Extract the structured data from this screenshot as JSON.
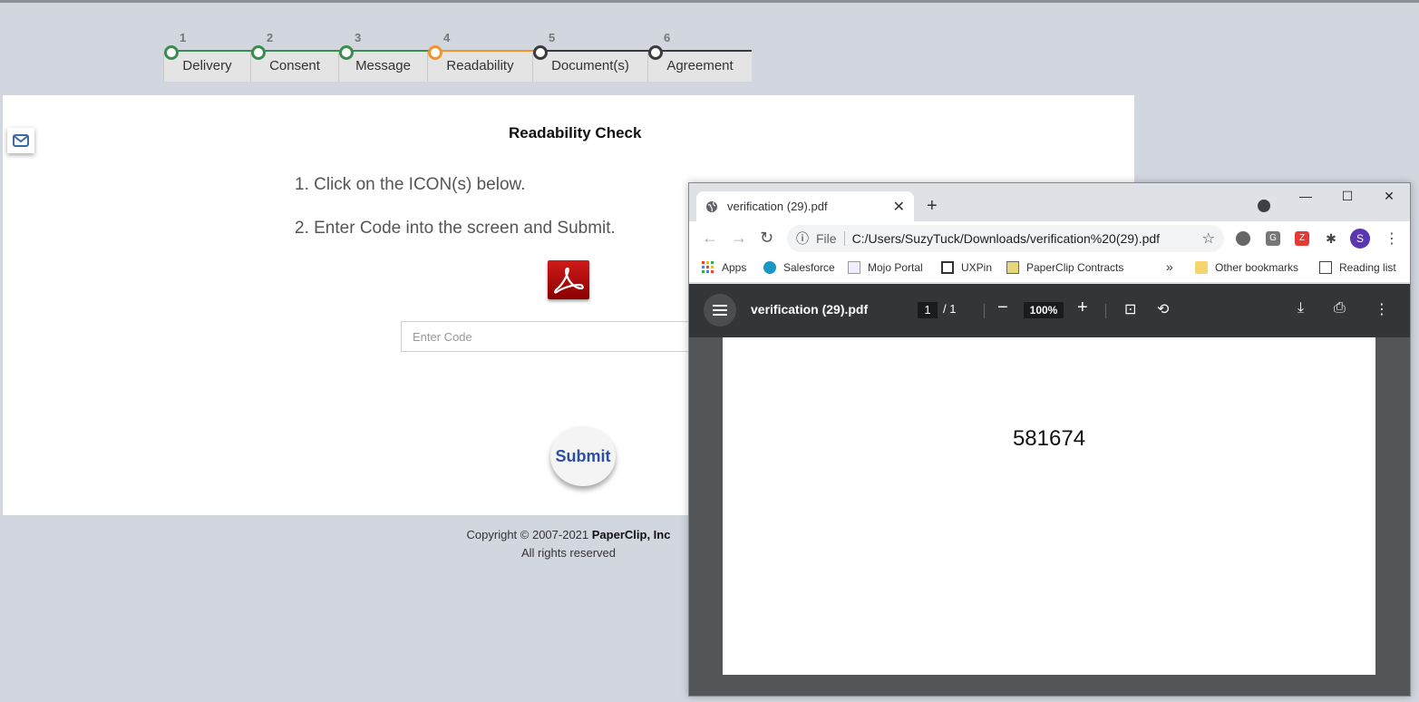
{
  "steps": [
    {
      "num": "1",
      "label": "Delivery",
      "color": "#3b8d4f"
    },
    {
      "num": "2",
      "label": "Consent",
      "color": "#3b8d4f"
    },
    {
      "num": "3",
      "label": "Message",
      "color": "#3b8d4f"
    },
    {
      "num": "4",
      "label": "Readability",
      "color": "#f0952a"
    },
    {
      "num": "5",
      "label": "Document(s)",
      "color": "#3d3a3f"
    },
    {
      "num": "6",
      "label": "Agreement",
      "color": "#3d3a3f"
    }
  ],
  "main": {
    "title": "Readability Check",
    "instruction_1": "1. Click on the ICON(s) below.",
    "instruction_2": "2. Enter Code into the screen and Submit.",
    "code_placeholder": "Enter Code",
    "submit_label": "Submit",
    "pdf_icon": "adobe-acrobat-icon"
  },
  "footer": {
    "copyright_prefix": "Copyright © 2007-2021 ",
    "company": "PaperClip, Inc",
    "rights": "All rights reserved"
  },
  "browser": {
    "tab_title": "verification (29).pdf",
    "omnibox_scheme": "File",
    "url": "C:/Users/SuzyTuck/Downloads/verification%20(29).pdf",
    "avatar_letter": "S",
    "bookmarks": {
      "apps": "Apps",
      "salesforce": "Salesforce",
      "mojo": "Mojo Portal",
      "uxpin": "UXPin",
      "paperclip": "PaperClip Contracts",
      "more": "»",
      "other": "Other bookmarks",
      "reading": "Reading list"
    },
    "pdf": {
      "name": "verification (29).pdf",
      "page": "1",
      "page_total": "/  1",
      "zoom": "100%",
      "code": "581674"
    }
  }
}
